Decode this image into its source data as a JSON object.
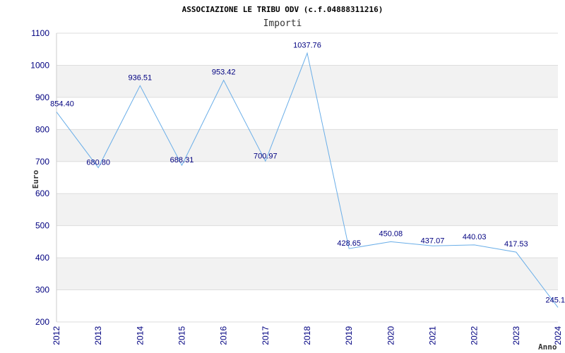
{
  "chart_data": {
    "type": "line",
    "title": "ASSOCIAZIONE LE TRIBU ODV (c.f.04888311216)",
    "subtitle": "Importi",
    "xlabel": "Anno",
    "ylabel": "Euro",
    "ylim": [
      200,
      1100
    ],
    "yticks": [
      200,
      300,
      400,
      500,
      600,
      700,
      800,
      900,
      1000,
      1100
    ],
    "grid": true,
    "categories": [
      "2012",
      "2013",
      "2014",
      "2015",
      "2016",
      "2017",
      "2018",
      "2019",
      "2020",
      "2021",
      "2022",
      "2023",
      "2024"
    ],
    "series": [
      {
        "values": [
          854.4,
          680.8,
          936.51,
          688.31,
          953.42,
          700.97,
          1037.76,
          428.65,
          450.08,
          437.07,
          440.03,
          417.53,
          245.17
        ],
        "labels": [
          "854.40",
          "680.80",
          "936.51",
          "688.31",
          "953.42",
          "700.97",
          "1037.76",
          "428.65",
          "450.08",
          "437.07",
          "440.03",
          "417.53",
          "245.1"
        ]
      }
    ],
    "colors": {
      "line": "#6aaee8",
      "band": "#f2f2f2",
      "gridline": "#dddddd",
      "axis_text": "#000080"
    }
  }
}
